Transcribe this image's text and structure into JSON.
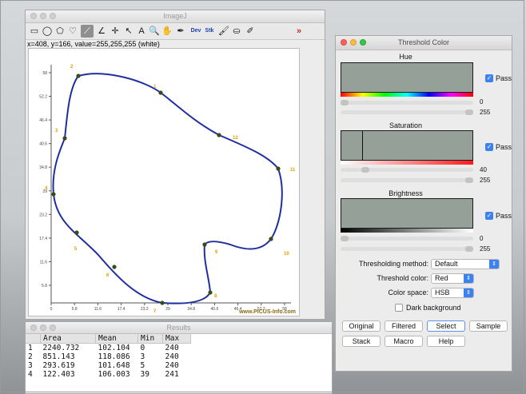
{
  "imagej": {
    "title": "ImageJ",
    "status": "x=408, y=166, value=255,255,255 (white)",
    "tools": [
      {
        "name": "rectangle-tool-icon",
        "glyph": "▭"
      },
      {
        "name": "oval-tool-icon",
        "glyph": "◯"
      },
      {
        "name": "polygon-tool-icon",
        "glyph": "⬠"
      },
      {
        "name": "freehand-tool-icon",
        "glyph": "♡"
      },
      {
        "name": "line-tool-icon",
        "glyph": "⟋"
      },
      {
        "name": "angle-tool-icon",
        "glyph": "∠"
      },
      {
        "name": "point-tool-icon",
        "glyph": "✛"
      },
      {
        "name": "wand-tool-icon",
        "glyph": "↖"
      },
      {
        "name": "text-tool-icon",
        "glyph": "A"
      },
      {
        "name": "zoom-tool-icon",
        "glyph": "🔍"
      },
      {
        "name": "hand-tool-icon",
        "glyph": "✋"
      },
      {
        "name": "dropper-tool-icon",
        "glyph": "✒"
      },
      {
        "name": "dev-menu-icon",
        "glyph": "Dev"
      },
      {
        "name": "stk-menu-icon",
        "glyph": "Stk"
      },
      {
        "name": "brush-tool-icon",
        "glyph": "🖌"
      },
      {
        "name": "flood-fill-icon",
        "glyph": "⛀"
      },
      {
        "name": "pencil-tool-icon",
        "glyph": "✐"
      },
      {
        "name": "more-tools-icon",
        "glyph": "»"
      }
    ]
  },
  "plot": {
    "y_ticks": [
      "58",
      "52.2",
      "46.4",
      "40.6",
      "34.8",
      "29",
      "23.2",
      "17.4",
      "11.6",
      "5.8"
    ],
    "x_ticks": [
      "0",
      "5.8",
      "11.6",
      "17.4",
      "23.2",
      "29",
      "34.8",
      "40.6",
      "46.4",
      "52.2",
      "58"
    ],
    "point_labels": [
      "1",
      "2",
      "3",
      "4",
      "5",
      "6",
      "7",
      "8",
      "9",
      "10",
      "11",
      "12"
    ],
    "watermark": "www.PICUS-Info.com",
    "accent": "#1f2fa0"
  },
  "results": {
    "title": "Results",
    "columns": [
      "",
      "Area",
      "Mean",
      "Min",
      "Max"
    ],
    "rows": [
      [
        "1",
        "2240.732",
        "102.104",
        "0",
        "240"
      ],
      [
        "2",
        "851.143",
        "118.086",
        "3",
        "240"
      ],
      [
        "3",
        "293.619",
        "101.648",
        "5",
        "240"
      ],
      [
        "4",
        "122.403",
        "106.003",
        "39",
        "241"
      ]
    ]
  },
  "threshold": {
    "title": "Threshold Color",
    "hue": {
      "label": "Hue",
      "pass": "Pass",
      "min": "0",
      "max": "255"
    },
    "saturation": {
      "label": "Saturation",
      "pass": "Pass",
      "min": "40",
      "max": "255",
      "level": 40
    },
    "brightness": {
      "label": "Brightness",
      "pass": "Pass",
      "min": "0",
      "max": "255"
    },
    "method_label": "Thresholding method:",
    "method_value": "Default",
    "color_label": "Threshold color:",
    "color_value": "Red",
    "space_label": "Color space:",
    "space_value": "HSB",
    "dark_background": "Dark background",
    "buttons_row1": [
      "Original",
      "Filtered",
      "Select",
      "Sample"
    ],
    "buttons_row2": [
      "Stack",
      "Macro",
      "Help"
    ],
    "hist_color": "#95a098",
    "accent": "#3b82f0"
  }
}
